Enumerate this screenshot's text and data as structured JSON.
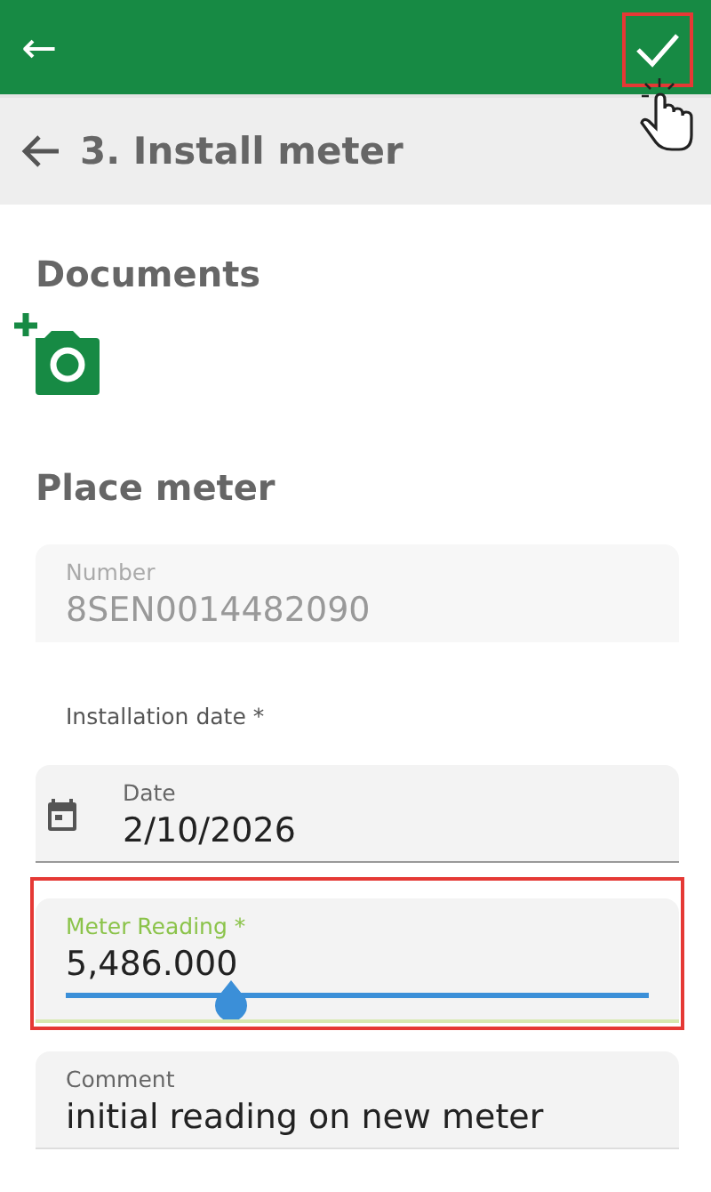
{
  "app_bar": {
    "back_icon": "←",
    "confirm_highlighted": true
  },
  "header": {
    "title": "3. Install meter"
  },
  "documents": {
    "heading": "Documents"
  },
  "place_meter": {
    "heading": "Place meter",
    "fields": [
      {
        "kind": "text",
        "label": "Number",
        "value": "8SEN0014482090",
        "disabled": true,
        "focused": false,
        "highlighted": false
      },
      {
        "kind": "date",
        "caption": "Installation date *",
        "label": "Date",
        "value": "2/10/2026",
        "disabled": false,
        "focused": false,
        "highlighted": false
      },
      {
        "kind": "text",
        "label": "Meter Reading *",
        "value": "5,486.000",
        "disabled": false,
        "focused": true,
        "highlighted": true
      },
      {
        "kind": "text",
        "label": "Comment",
        "value": "initial reading on new meter",
        "disabled": false,
        "focused": false,
        "highlighted": false
      }
    ]
  }
}
